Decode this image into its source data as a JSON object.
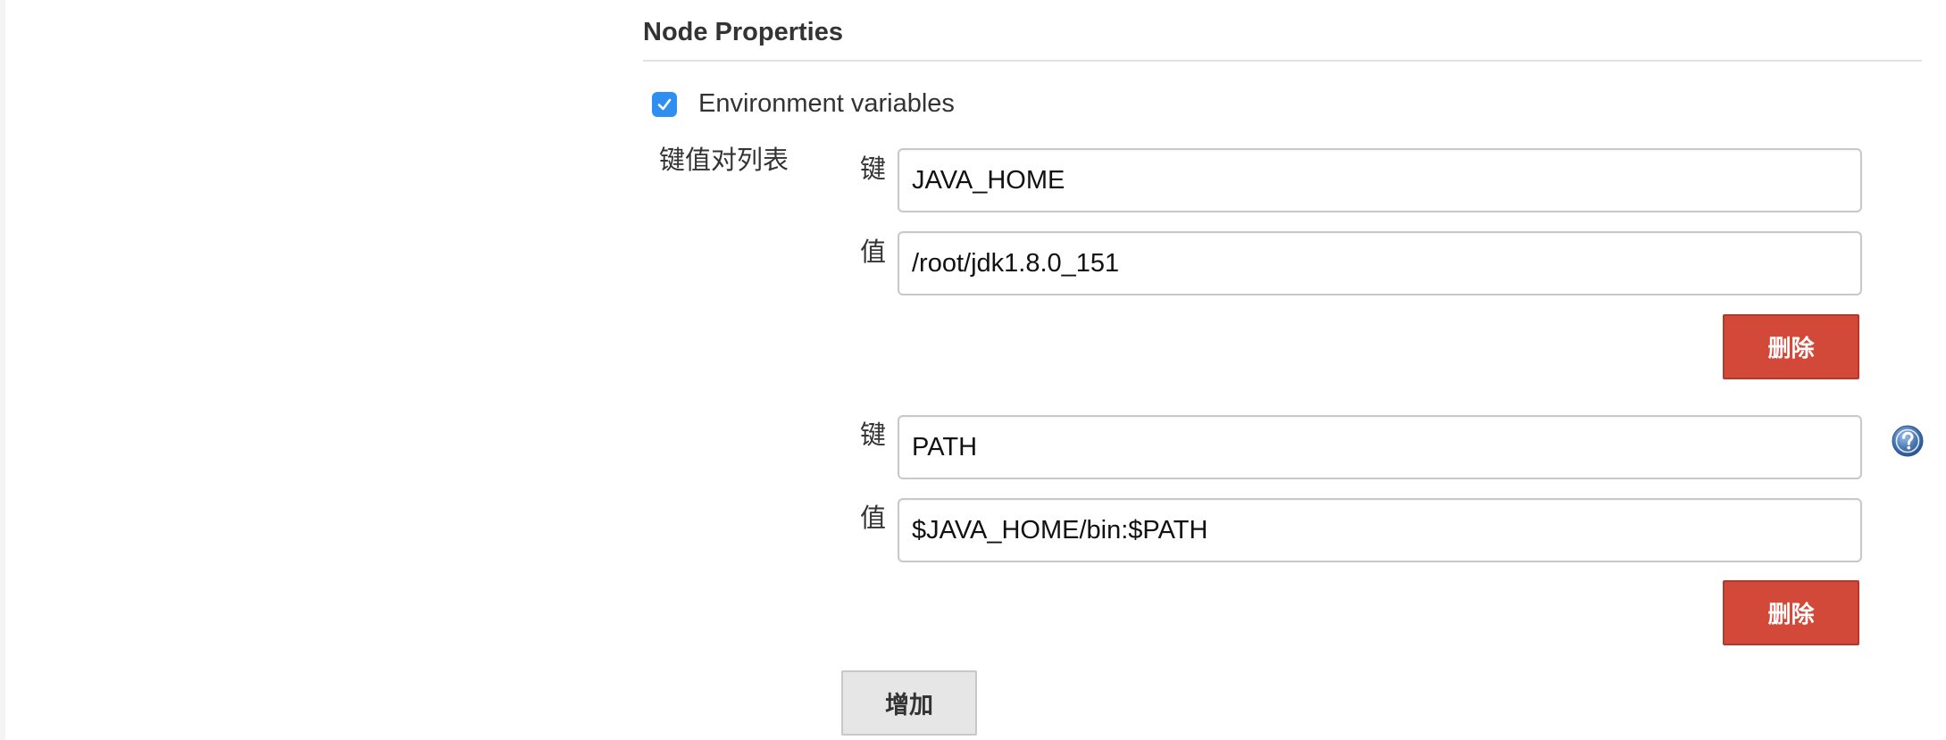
{
  "section": {
    "title": "Node Properties"
  },
  "env_vars": {
    "checkbox_checked": true,
    "label": "Environment variables",
    "list_label": "键值对列表",
    "entries": [
      {
        "key_label": "键",
        "key_value": "JAVA_HOME",
        "value_label": "值",
        "value_value": "/root/jdk1.8.0_151",
        "delete_label": "删除"
      },
      {
        "key_label": "键",
        "key_value": "PATH",
        "value_label": "值",
        "value_value": "$JAVA_HOME/bin:$PATH",
        "delete_label": "删除"
      }
    ],
    "add_label": "增加"
  },
  "icons": {
    "checkbox": "check-icon",
    "help": "help-icon"
  },
  "colors": {
    "checkbox_blue": "#2e8ff1",
    "delete_red": "#d24939",
    "add_gray": "#e6e6e6",
    "help_blue": "#4a78b5"
  }
}
